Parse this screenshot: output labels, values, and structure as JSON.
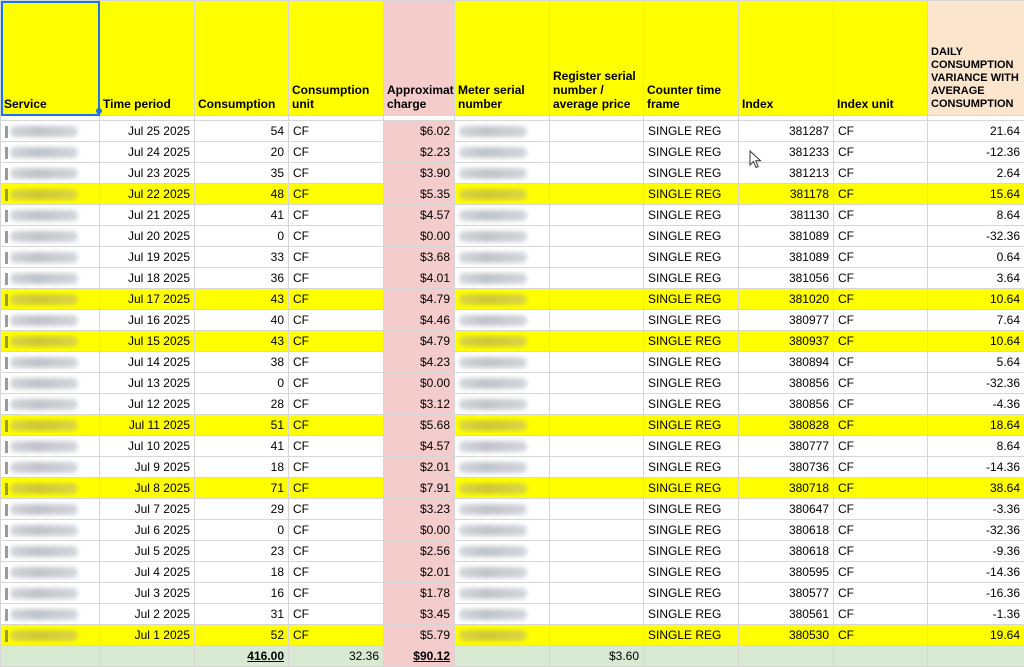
{
  "headers": {
    "service": "Service",
    "time_period": "Time period",
    "consumption": "Consumption",
    "consumption_unit": "Consumption unit",
    "approx_charge": "Approximate charge",
    "meter_serial": "Meter serial number",
    "register_serial": "Register serial number / average price",
    "counter_time_frame": "Counter time frame",
    "index": "Index",
    "index_unit": "Index unit",
    "daily_variance": "DAILY CONSUMPTION VARIANCE WITH AVERAGE CONSUMPTION"
  },
  "rows": [
    {
      "date": "Jul 25 2025",
      "consumption": "54",
      "unit": "CF",
      "charge": "$6.02",
      "frame": "SINGLE REG",
      "index": "381287",
      "index_unit": "CF",
      "variance": "21.64",
      "highlight": false
    },
    {
      "date": "Jul 24 2025",
      "consumption": "20",
      "unit": "CF",
      "charge": "$2.23",
      "frame": "SINGLE REG",
      "index": "381233",
      "index_unit": "CF",
      "variance": "-12.36",
      "highlight": false
    },
    {
      "date": "Jul 23 2025",
      "consumption": "35",
      "unit": "CF",
      "charge": "$3.90",
      "frame": "SINGLE REG",
      "index": "381213",
      "index_unit": "CF",
      "variance": "2.64",
      "highlight": false
    },
    {
      "date": "Jul 22 2025",
      "consumption": "48",
      "unit": "CF",
      "charge": "$5.35",
      "frame": "SINGLE REG",
      "index": "381178",
      "index_unit": "CF",
      "variance": "15.64",
      "highlight": true
    },
    {
      "date": "Jul 21 2025",
      "consumption": "41",
      "unit": "CF",
      "charge": "$4.57",
      "frame": "SINGLE REG",
      "index": "381130",
      "index_unit": "CF",
      "variance": "8.64",
      "highlight": false
    },
    {
      "date": "Jul 20 2025",
      "consumption": "0",
      "unit": "CF",
      "charge": "$0.00",
      "frame": "SINGLE REG",
      "index": "381089",
      "index_unit": "CF",
      "variance": "-32.36",
      "highlight": false
    },
    {
      "date": "Jul 19 2025",
      "consumption": "33",
      "unit": "CF",
      "charge": "$3.68",
      "frame": "SINGLE REG",
      "index": "381089",
      "index_unit": "CF",
      "variance": "0.64",
      "highlight": false
    },
    {
      "date": "Jul 18 2025",
      "consumption": "36",
      "unit": "CF",
      "charge": "$4.01",
      "frame": "SINGLE REG",
      "index": "381056",
      "index_unit": "CF",
      "variance": "3.64",
      "highlight": false
    },
    {
      "date": "Jul 17 2025",
      "consumption": "43",
      "unit": "CF",
      "charge": "$4.79",
      "frame": "SINGLE REG",
      "index": "381020",
      "index_unit": "CF",
      "variance": "10.64",
      "highlight": true
    },
    {
      "date": "Jul 16 2025",
      "consumption": "40",
      "unit": "CF",
      "charge": "$4.46",
      "frame": "SINGLE REG",
      "index": "380977",
      "index_unit": "CF",
      "variance": "7.64",
      "highlight": false
    },
    {
      "date": "Jul 15 2025",
      "consumption": "43",
      "unit": "CF",
      "charge": "$4.79",
      "frame": "SINGLE REG",
      "index": "380937",
      "index_unit": "CF",
      "variance": "10.64",
      "highlight": true
    },
    {
      "date": "Jul 14 2025",
      "consumption": "38",
      "unit": "CF",
      "charge": "$4.23",
      "frame": "SINGLE REG",
      "index": "380894",
      "index_unit": "CF",
      "variance": "5.64",
      "highlight": false
    },
    {
      "date": "Jul 13 2025",
      "consumption": "0",
      "unit": "CF",
      "charge": "$0.00",
      "frame": "SINGLE REG",
      "index": "380856",
      "index_unit": "CF",
      "variance": "-32.36",
      "highlight": false
    },
    {
      "date": "Jul 12 2025",
      "consumption": "28",
      "unit": "CF",
      "charge": "$3.12",
      "frame": "SINGLE REG",
      "index": "380856",
      "index_unit": "CF",
      "variance": "-4.36",
      "highlight": false
    },
    {
      "date": "Jul 11 2025",
      "consumption": "51",
      "unit": "CF",
      "charge": "$5.68",
      "frame": "SINGLE REG",
      "index": "380828",
      "index_unit": "CF",
      "variance": "18.64",
      "highlight": true
    },
    {
      "date": "Jul 10 2025",
      "consumption": "41",
      "unit": "CF",
      "charge": "$4.57",
      "frame": "SINGLE REG",
      "index": "380777",
      "index_unit": "CF",
      "variance": "8.64",
      "highlight": false
    },
    {
      "date": "Jul 9 2025",
      "consumption": "18",
      "unit": "CF",
      "charge": "$2.01",
      "frame": "SINGLE REG",
      "index": "380736",
      "index_unit": "CF",
      "variance": "-14.36",
      "highlight": false
    },
    {
      "date": "Jul 8 2025",
      "consumption": "71",
      "unit": "CF",
      "charge": "$7.91",
      "frame": "SINGLE REG",
      "index": "380718",
      "index_unit": "CF",
      "variance": "38.64",
      "highlight": true
    },
    {
      "date": "Jul 7 2025",
      "consumption": "29",
      "unit": "CF",
      "charge": "$3.23",
      "frame": "SINGLE REG",
      "index": "380647",
      "index_unit": "CF",
      "variance": "-3.36",
      "highlight": false
    },
    {
      "date": "Jul 6 2025",
      "consumption": "0",
      "unit": "CF",
      "charge": "$0.00",
      "frame": "SINGLE REG",
      "index": "380618",
      "index_unit": "CF",
      "variance": "-32.36",
      "highlight": false
    },
    {
      "date": "Jul 5 2025",
      "consumption": "23",
      "unit": "CF",
      "charge": "$2.56",
      "frame": "SINGLE REG",
      "index": "380618",
      "index_unit": "CF",
      "variance": "-9.36",
      "highlight": false
    },
    {
      "date": "Jul 4 2025",
      "consumption": "18",
      "unit": "CF",
      "charge": "$2.01",
      "frame": "SINGLE REG",
      "index": "380595",
      "index_unit": "CF",
      "variance": "-14.36",
      "highlight": false
    },
    {
      "date": "Jul 3 2025",
      "consumption": "16",
      "unit": "CF",
      "charge": "$1.78",
      "frame": "SINGLE REG",
      "index": "380577",
      "index_unit": "CF",
      "variance": "-16.36",
      "highlight": false
    },
    {
      "date": "Jul 2 2025",
      "consumption": "31",
      "unit": "CF",
      "charge": "$3.45",
      "frame": "SINGLE REG",
      "index": "380561",
      "index_unit": "CF",
      "variance": "-1.36",
      "highlight": false
    },
    {
      "date": "Jul 1 2025",
      "consumption": "52",
      "unit": "CF",
      "charge": "$5.79",
      "frame": "SINGLE REG",
      "index": "380530",
      "index_unit": "CF",
      "variance": "19.64",
      "highlight": true
    }
  ],
  "totals": {
    "consumption_total": "416.00",
    "average": "32.36",
    "charge_total": "$90.12",
    "average_price": "$3.60"
  },
  "colors": {
    "header_yellow": "#ffff00",
    "charge_pink": "#f4cccc",
    "variance_header": "#fce5cd",
    "totals_green": "#d9ead3",
    "selection_blue": "#1a73e8"
  },
  "icons": [
    "mouse-cursor-icon"
  ]
}
